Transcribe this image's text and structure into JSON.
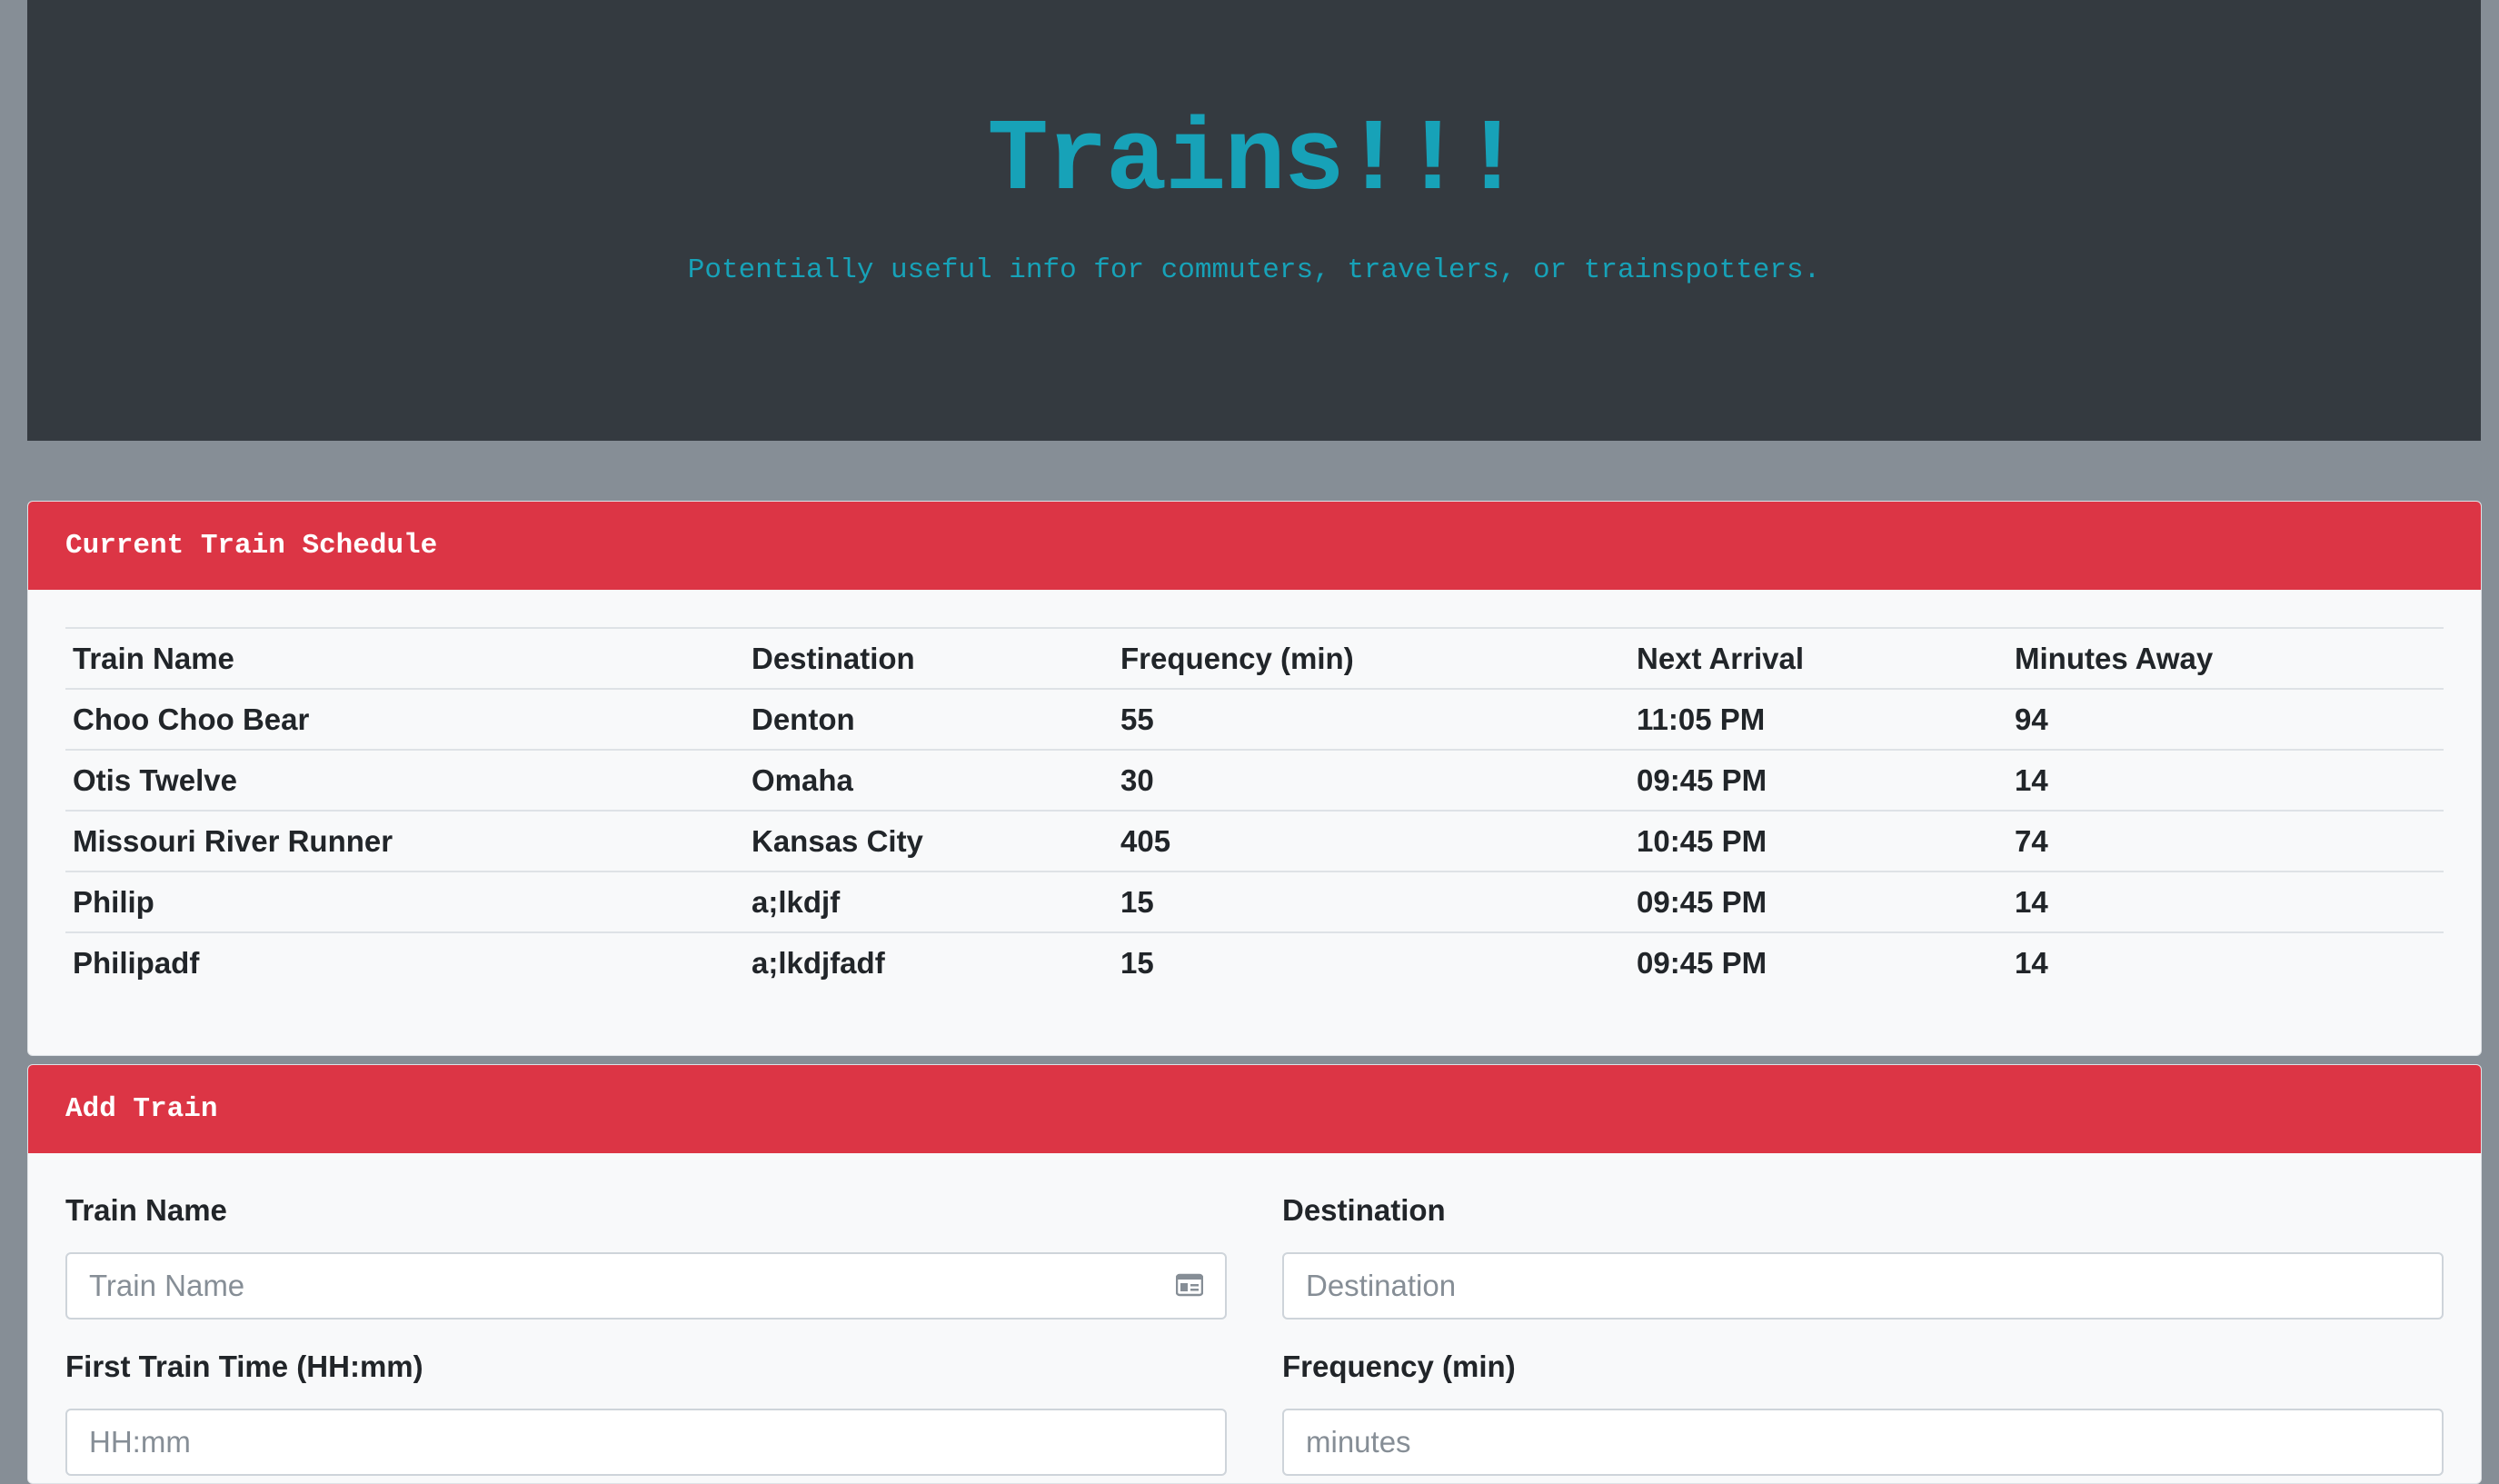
{
  "header": {
    "title": "Trains!!!",
    "subtitle": "Potentially useful info for commuters, travelers, or trainspotters."
  },
  "schedule": {
    "title": "Current Train Schedule",
    "columns": [
      "Train Name",
      "Destination",
      "Frequency (min)",
      "Next Arrival",
      "Minutes Away"
    ],
    "rows": [
      [
        "Choo Choo Bear",
        "Denton",
        "55",
        "11:05 PM",
        "94"
      ],
      [
        "Otis Twelve",
        "Omaha",
        "30",
        "09:45 PM",
        "14"
      ],
      [
        "Missouri River Runner",
        "Kansas City",
        "405",
        "10:45 PM",
        "74"
      ],
      [
        "Philip",
        "a;lkdjf",
        "15",
        "09:45 PM",
        "14"
      ],
      [
        "Philipadf",
        "a;lkdjfadf",
        "15",
        "09:45 PM",
        "14"
      ]
    ]
  },
  "add_train": {
    "title": "Add Train",
    "train_name": {
      "label": "Train Name",
      "placeholder": "Train Name",
      "value": "",
      "icon": "id-card-icon"
    },
    "destination": {
      "label": "Destination",
      "placeholder": "Destination",
      "value": ""
    },
    "first_time": {
      "label": "First Train Time (HH:mm)",
      "placeholder": "HH:mm",
      "value": ""
    },
    "frequency": {
      "label": "Frequency (min)",
      "placeholder": "minutes",
      "value": ""
    }
  },
  "colors": {
    "page_bg": "#868e96",
    "jumbotron_bg": "#343a40",
    "accent_teal": "#17a2b8",
    "header_red": "#dc3545",
    "card_bg": "#f8f9fa"
  }
}
